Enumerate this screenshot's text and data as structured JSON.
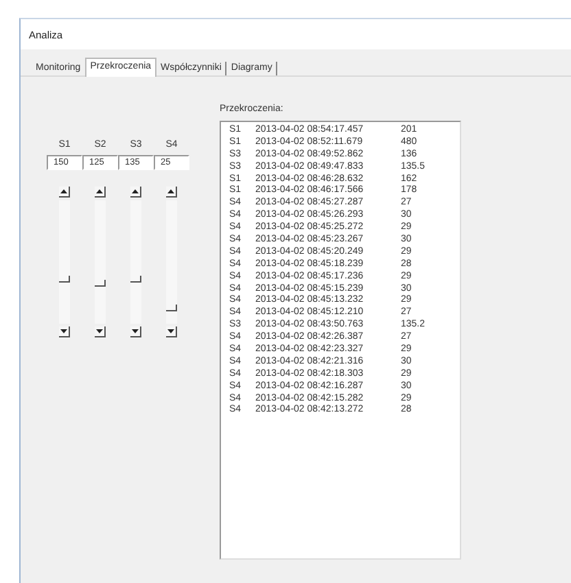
{
  "window": {
    "title": "Analiza"
  },
  "tabs": [
    {
      "label": "Monitoring",
      "selected": false
    },
    {
      "label": "Przekroczenia",
      "selected": true
    },
    {
      "label": "Współczynniki",
      "selected": false
    },
    {
      "label": "Diagramy",
      "selected": false
    }
  ],
  "sliders": [
    {
      "label": "S1",
      "value": "150",
      "level": 0.35
    },
    {
      "label": "S2",
      "value": "125",
      "level": 0.31
    },
    {
      "label": "S3",
      "value": "135",
      "level": 0.35
    },
    {
      "label": "S4",
      "value": "25",
      "level": 0.1
    }
  ],
  "list_label": "Przekroczenia:",
  "list": [
    {
      "sensor": "S1",
      "time": "2013-04-02 08:54:17.457",
      "value": "201"
    },
    {
      "sensor": "S1",
      "time": "2013-04-02 08:52:11.679",
      "value": "480"
    },
    {
      "sensor": "S3",
      "time": "2013-04-02 08:49:52.862",
      "value": "136"
    },
    {
      "sensor": "S3",
      "time": "2013-04-02 08:49:47.833",
      "value": "135.5"
    },
    {
      "sensor": "S1",
      "time": "2013-04-02 08:46:28.632",
      "value": "162"
    },
    {
      "sensor": "S1",
      "time": "2013-04-02 08:46:17.566",
      "value": "178"
    },
    {
      "sensor": "S4",
      "time": "2013-04-02 08:45:27.287",
      "value": "27"
    },
    {
      "sensor": "S4",
      "time": "2013-04-02 08:45:26.293",
      "value": "30"
    },
    {
      "sensor": "S4",
      "time": "2013-04-02 08:45:25.272",
      "value": "29"
    },
    {
      "sensor": "S4",
      "time": "2013-04-02 08:45:23.267",
      "value": "30"
    },
    {
      "sensor": "S4",
      "time": "2013-04-02 08:45:20.249",
      "value": "29"
    },
    {
      "sensor": "S4",
      "time": "2013-04-02 08:45:18.239",
      "value": "28"
    },
    {
      "sensor": "S4",
      "time": "2013-04-02 08:45:17.236",
      "value": "29"
    },
    {
      "sensor": "S4",
      "time": "2013-04-02 08:45:15.239",
      "value": "30"
    },
    {
      "sensor": "S4",
      "time": "2013-04-02 08:45:13.232",
      "value": "29"
    },
    {
      "sensor": "S4",
      "time": "2013-04-02 08:45:12.210",
      "value": "27"
    },
    {
      "sensor": "S3",
      "time": "2013-04-02 08:43:50.763",
      "value": "135.2"
    },
    {
      "sensor": "S4",
      "time": "2013-04-02 08:42:26.387",
      "value": "27"
    },
    {
      "sensor": "S4",
      "time": "2013-04-02 08:42:23.327",
      "value": "29"
    },
    {
      "sensor": "S4",
      "time": "2013-04-02 08:42:21.316",
      "value": "30"
    },
    {
      "sensor": "S4",
      "time": "2013-04-02 08:42:18.303",
      "value": "29"
    },
    {
      "sensor": "S4",
      "time": "2013-04-02 08:42:16.287",
      "value": "30"
    },
    {
      "sensor": "S4",
      "time": "2013-04-02 08:42:15.282",
      "value": "29"
    },
    {
      "sensor": "S4",
      "time": "2013-04-02 08:42:13.272",
      "value": "28"
    }
  ]
}
